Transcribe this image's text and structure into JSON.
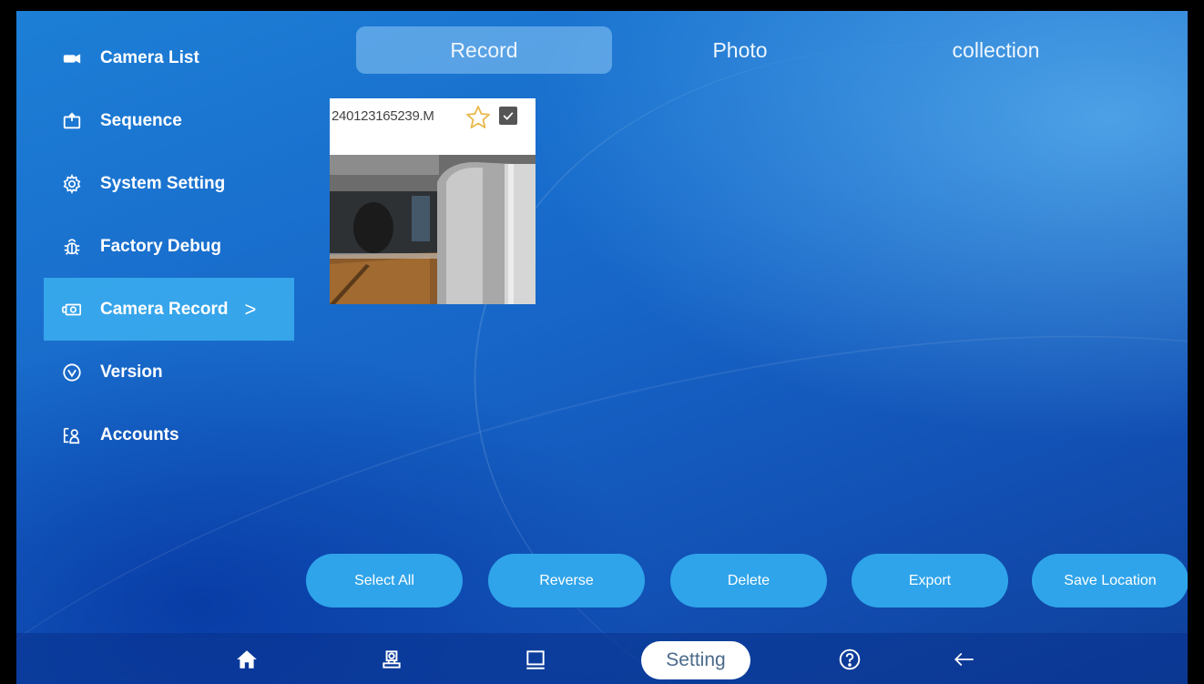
{
  "sidebar": {
    "items": [
      {
        "label": "Camera List",
        "icon": "camera-icon"
      },
      {
        "label": "Sequence",
        "icon": "sequence-icon"
      },
      {
        "label": "System Setting",
        "icon": "gear-icon"
      },
      {
        "label": "Factory Debug",
        "icon": "bug-icon"
      },
      {
        "label": "Camera Record",
        "icon": "record-icon",
        "active": true
      },
      {
        "label": "Version",
        "icon": "version-icon"
      },
      {
        "label": "Accounts",
        "icon": "accounts-icon"
      }
    ],
    "active_chevron": ">"
  },
  "tabs": [
    {
      "label": "Record",
      "active": true
    },
    {
      "label": "Photo"
    },
    {
      "label": "collection"
    }
  ],
  "recordings": [
    {
      "name": "240123165239.M",
      "favorite": false,
      "checked": true
    }
  ],
  "actions": {
    "select_all": "Select All",
    "reverse": "Reverse",
    "delete": "Delete",
    "export": "Export",
    "save_location": "Save Location"
  },
  "bottom_nav": {
    "items": [
      "home-icon",
      "robot-icon",
      "monitor-icon",
      "help-icon",
      "back-arrow-icon"
    ],
    "setting_label": "Setting"
  },
  "colors": {
    "accent": "#2fa4ea",
    "active_sidebar": "#3cafef",
    "background": "#1766c8"
  }
}
